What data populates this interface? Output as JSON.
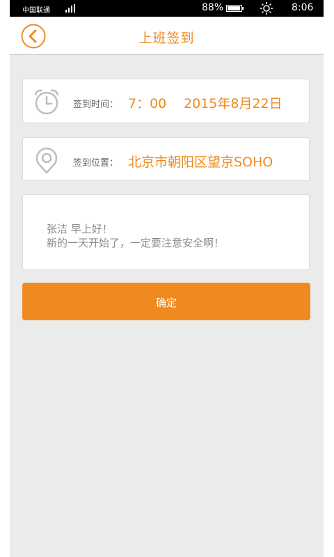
{
  "status_bar": {
    "carrier": "中国联通",
    "battery_percent": "88%",
    "time": "8:06"
  },
  "header": {
    "title": "上班签到"
  },
  "checkin": {
    "time_label": "签到时间：",
    "time_value": "7：00",
    "date_value": "2015年8月22日",
    "location_label": "签到位置：",
    "location_value": "北京市朝阳区望京SOHO"
  },
  "message": {
    "line1": "张洁 早上好！",
    "line2": "新的一天开始了，一定要注意安全啊！"
  },
  "confirm_label": "确定",
  "colors": {
    "accent": "#ef8a1f",
    "background": "#ebebeb"
  },
  "icons": [
    "back-chevron-icon",
    "alarm-clock-icon",
    "location-pin-icon",
    "signal-icon",
    "battery-icon",
    "brightness-icon"
  ]
}
